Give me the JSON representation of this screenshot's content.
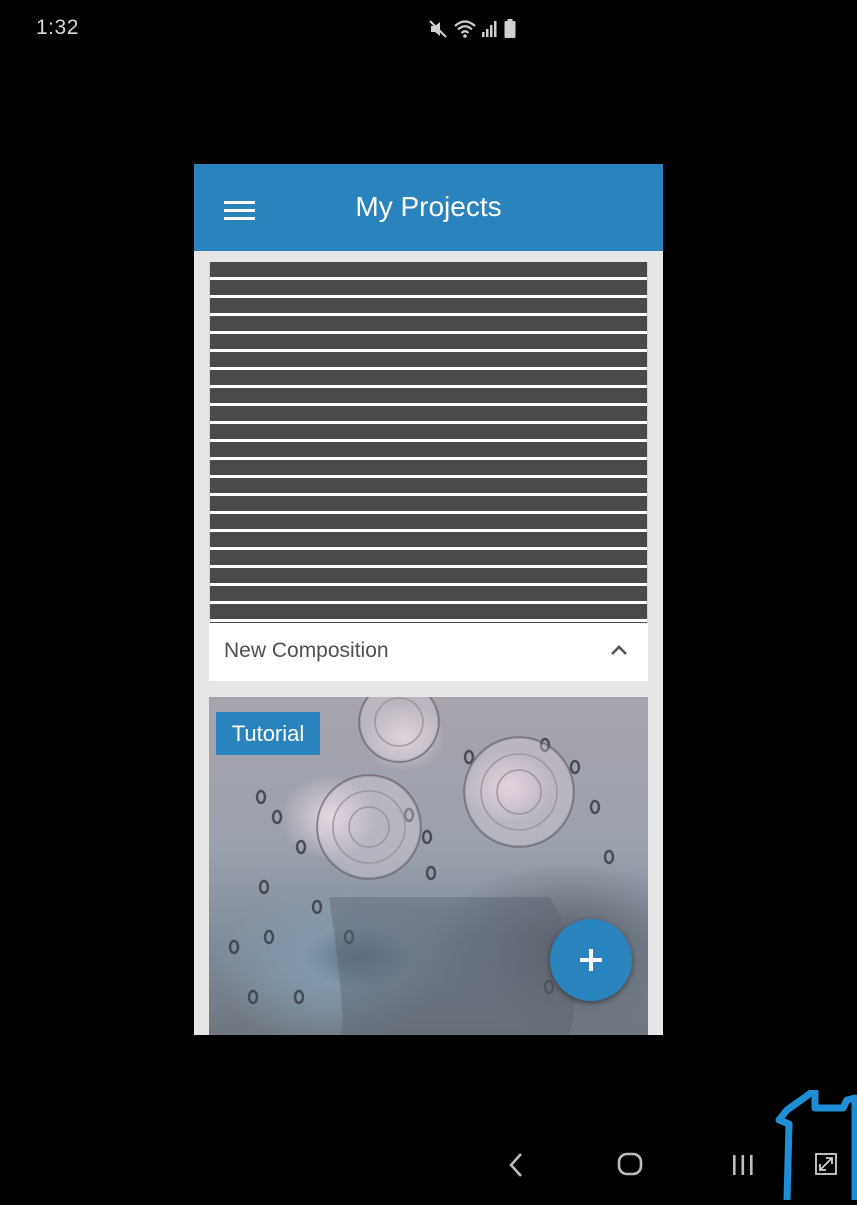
{
  "status_bar": {
    "time": "1:32",
    "icons": [
      "mute-icon",
      "wifi-icon",
      "signal-icon",
      "battery-icon"
    ]
  },
  "app_bar": {
    "menu_icon": "hamburger-menu-icon",
    "title": "My Projects"
  },
  "projects": {
    "composition_label": "New Composition",
    "collapse_icon": "chevron-up-icon",
    "tutorial_badge": "Tutorial"
  },
  "fab": {
    "icon": "plus-icon"
  },
  "navigation_bar": {
    "icons": [
      "back-icon",
      "home-icon",
      "recent-apps-icon",
      "expand-icon"
    ]
  },
  "colors": {
    "accent": "#2b83bd",
    "background": "#000000",
    "app_background": "#e6e6e6",
    "stripe_dark": "#4a4a4a"
  }
}
